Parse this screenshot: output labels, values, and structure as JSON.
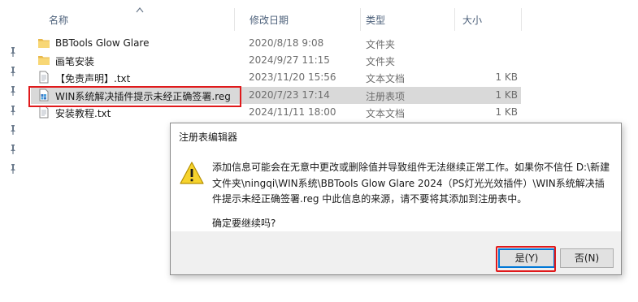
{
  "columns": {
    "name": "名称",
    "modified": "修改日期",
    "type": "类型",
    "size": "大小"
  },
  "files": [
    {
      "name": "BBTools Glow Glare",
      "modified": "2020/8/18 9:08",
      "type": "文件夹",
      "size": "",
      "icon": "folder-icon",
      "selected": false
    },
    {
      "name": "画笔安装",
      "modified": "2024/9/27 11:15",
      "type": "文件夹",
      "size": "",
      "icon": "folder-icon",
      "selected": false
    },
    {
      "name": "【免责声明】.txt",
      "modified": "2023/11/20 15:56",
      "type": "文本文档",
      "size": "1 KB",
      "icon": "text-file-icon",
      "selected": false
    },
    {
      "name": "WIN系统解决插件提示未经正确签署.reg",
      "modified": "2020/7/23 17:14",
      "type": "注册表项",
      "size": "1 KB",
      "icon": "registry-file-icon",
      "selected": true
    },
    {
      "name": "安装教程.txt",
      "modified": "2024/11/11 18:00",
      "type": "文本文档",
      "size": "1 KB",
      "icon": "text-file-icon",
      "selected": false
    }
  ],
  "dialog": {
    "title": "注册表编辑器",
    "message_lines": [
      "添加信息可能会在无意中更改或删除值并导致组件无法继续正常工作。如果你不信任 D:\\新建",
      "文件夹\\ningqi\\WIN系统\\BBTools Glow Glare 2024（PS灯光光效插件）\\WIN系统解决插",
      "件提示未经正确签署.reg 中此信息的来源，请不要将其添加到注册表中。"
    ],
    "question": "确定要继续吗?",
    "yes_label": "是(Y)",
    "no_label": "否(N)"
  },
  "colors": {
    "highlight": "#e0191b",
    "selection": "#d9d9d9",
    "focus": "#0078d7",
    "folder": "#f8d775"
  }
}
